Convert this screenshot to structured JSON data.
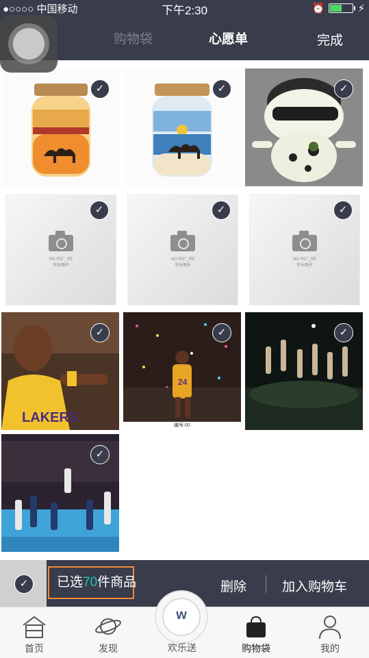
{
  "status_bar": {
    "carrier": "●○○○○ 中国移动",
    "time": "下午2:30"
  },
  "nav": {
    "tab_cart": "购物袋",
    "tab_wishlist": "心愿单",
    "done": "完成"
  },
  "placeholder_text": {
    "line1": "NO PIC\"_RE",
    "line2": "节乐图片"
  },
  "items": [
    {
      "name": "camel-sand-jar-orange",
      "selected": true
    },
    {
      "name": "camel-sand-jar-blue",
      "selected": true
    },
    {
      "name": "cartoon-toy",
      "selected": true
    },
    {
      "name": "no-picture",
      "selected": true
    },
    {
      "name": "no-picture",
      "selected": true
    },
    {
      "name": "no-picture",
      "selected": true
    },
    {
      "name": "basketball-player-photo",
      "selected": true
    },
    {
      "name": "basketball-celebration-photo",
      "selected": true
    },
    {
      "name": "basketball-team-photo",
      "selected": true
    },
    {
      "name": "basketball-game-photo",
      "selected": true
    }
  ],
  "photo_caption": "编号:00",
  "bottom_bar": {
    "selected_prefix": "已选",
    "selected_count": "70",
    "selected_suffix": "件商品",
    "delete": "删除",
    "add_to_cart": "加入购物车"
  },
  "tab_bar": {
    "home": "首页",
    "discover": "发现",
    "center": "欢乐送",
    "bag": "购物袋",
    "mine": "我的"
  },
  "colors": {
    "dark": "#383c4b",
    "accent_count": "#1fc7b6",
    "highlight_border": "#f08a3c"
  }
}
